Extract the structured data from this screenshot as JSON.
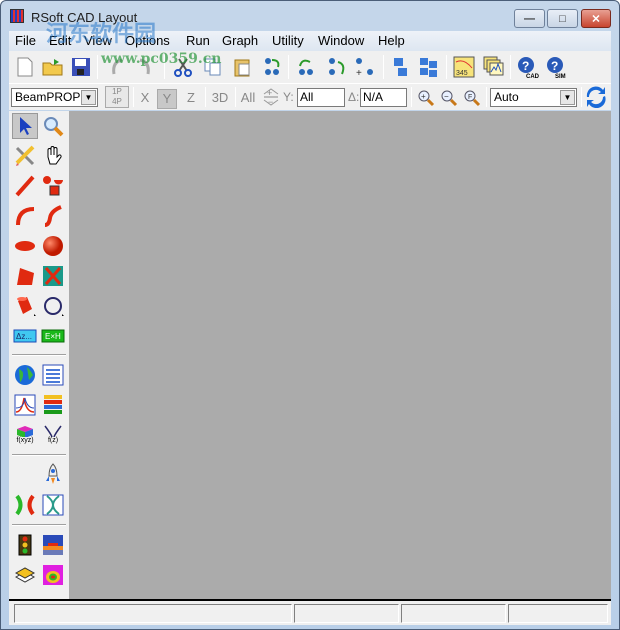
{
  "window": {
    "title": "RSoft CAD Layout",
    "controls": {
      "minimize": "▭",
      "maximize": "□",
      "close": "✕"
    }
  },
  "watermark": {
    "text": "河东软件园",
    "url_text": "www.pc0359.cn"
  },
  "menubar": {
    "items": [
      "File",
      "Edit",
      "View",
      "Options",
      "Run",
      "Graph",
      "Utility",
      "Window",
      "Help"
    ]
  },
  "toolbar1": {
    "buttons": [
      "new-file",
      "open-file",
      "save",
      "undo",
      "redo",
      "cut",
      "copy",
      "paste",
      "group",
      "ungroup-left",
      "ungroup-right",
      "add-component",
      "bring-front",
      "arrange",
      "plot-graph",
      "view-results",
      "help-cad",
      "help-sim"
    ],
    "help_cad_label": "CAD",
    "help_sim_label": "SIM"
  },
  "toolbar2": {
    "simulator_select": "BeamPROP",
    "pane_top": "1P",
    "pane_bottom": "4P",
    "axis_x": "X",
    "axis_y": "Y",
    "axis_z": "Z",
    "view_3d": "3D",
    "all_label": "All",
    "y_label": "Y:",
    "y_value": "All",
    "delta_label": "Δ:",
    "delta_value": "N/A",
    "zoom_mode_select": "Auto"
  },
  "palette": {
    "labels": {
      "dz": "Δz...",
      "exh": "E×H",
      "fxyz": "f(xyz)",
      "fz": "f(z)"
    }
  },
  "statusbar": {
    "panels": [
      "",
      "",
      "",
      ""
    ]
  }
}
